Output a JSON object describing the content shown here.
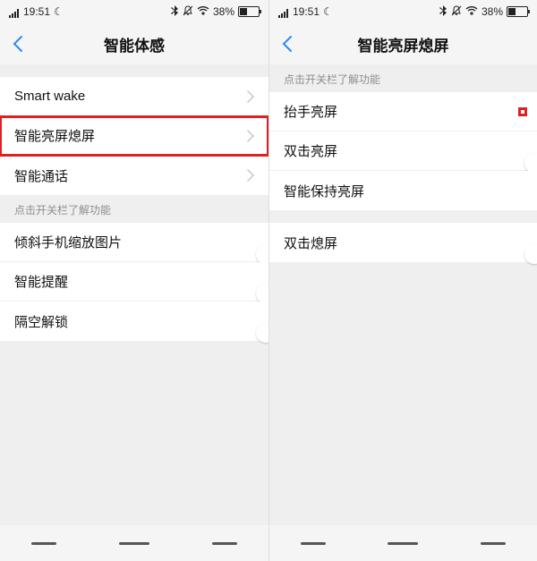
{
  "status": {
    "time": "19:51",
    "battery_pct": "38%"
  },
  "left": {
    "title": "智能体感",
    "group1": [
      {
        "label": "Smart wake"
      },
      {
        "label": "智能亮屏熄屏",
        "highlight": true
      },
      {
        "label": "智能通话"
      }
    ],
    "group2_header": "点击开关栏了解功能",
    "group2": [
      {
        "label": "倾斜手机缩放图片",
        "on": false
      },
      {
        "label": "智能提醒",
        "on": false
      },
      {
        "label": "隔空解锁",
        "on": false
      }
    ]
  },
  "right": {
    "title": "智能亮屏熄屏",
    "group1_header": "点击开关栏了解功能",
    "group1": [
      {
        "label": "抬手亮屏",
        "on": true,
        "highlight": true
      },
      {
        "label": "双击亮屏",
        "on": false
      },
      {
        "label": "智能保持亮屏",
        "on": true
      }
    ],
    "group2": [
      {
        "label": "双击熄屏",
        "on": false
      }
    ]
  }
}
